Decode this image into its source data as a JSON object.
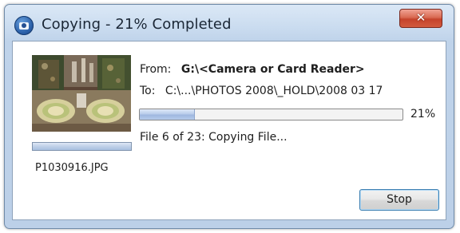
{
  "window": {
    "title": "Copying - 21% Completed",
    "close_label": "✕"
  },
  "copy": {
    "from_label": "From:",
    "from_path": "G:\\<Camera or Card Reader>",
    "to_label": "To:",
    "to_path": "C:\\...\\PHOTOS 2008\\_HOLD\\2008 03 17",
    "progress_percent": 21,
    "progress_text": "21%",
    "status": "File 6 of 23: Copying File..."
  },
  "thumbnail": {
    "file_name": "P1030916.JPG",
    "progress_percent": 100
  },
  "buttons": {
    "stop_label": "Stop"
  },
  "colors": {
    "title_bar": "#c9dbef",
    "close_button": "#c5432b",
    "progress_fill": "#b9cdea",
    "stop_button_border": "#3c7fb1"
  },
  "icons": {
    "app": "camera-icon",
    "close": "close-icon"
  }
}
